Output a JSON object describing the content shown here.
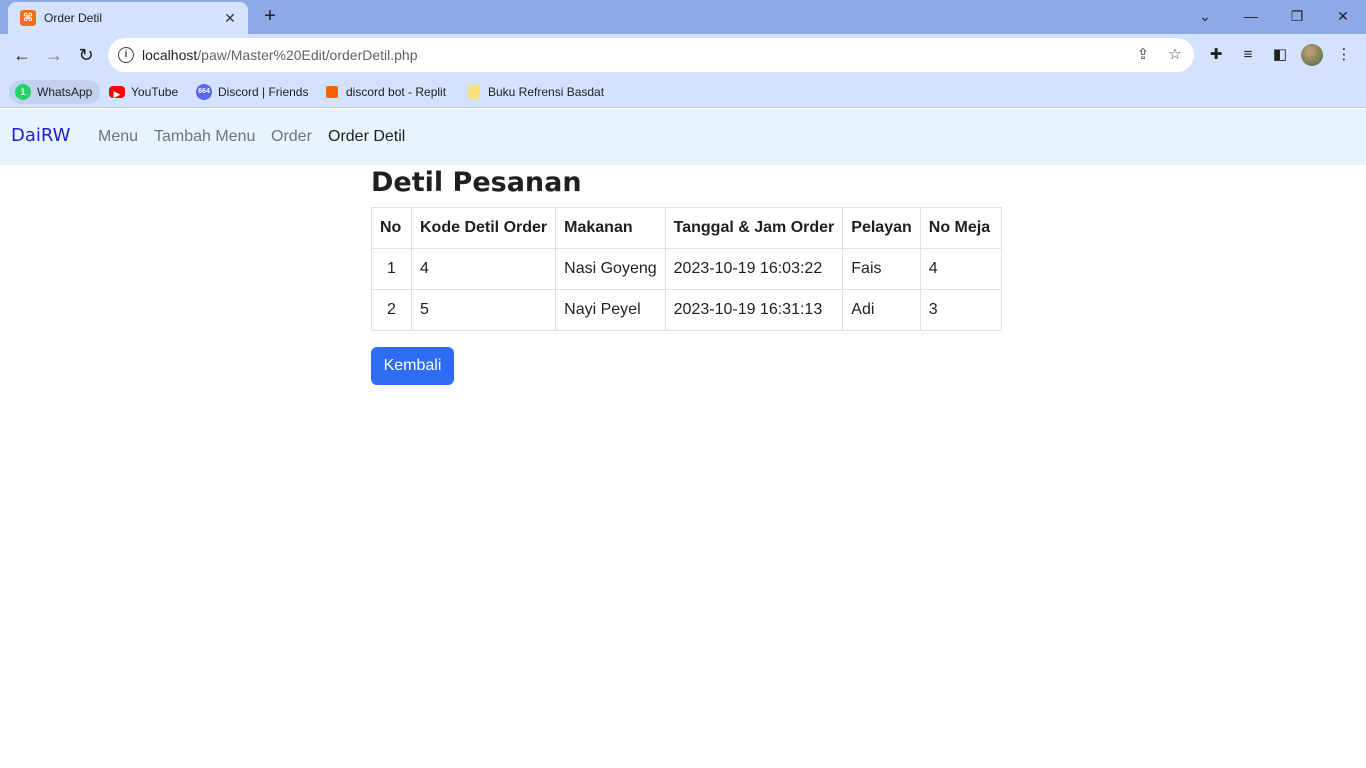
{
  "browser": {
    "tab_title": "Order Detil",
    "url_host": "localhost",
    "url_path": "/paw/Master%20Edit/orderDetil.php",
    "bookmarks": [
      {
        "label": "WhatsApp",
        "icon": "whatsapp-icon",
        "badge": "1",
        "color": "#25d366"
      },
      {
        "label": "YouTube",
        "icon": "youtube-icon",
        "color": "#ff0000"
      },
      {
        "label": "Discord | Friends",
        "icon": "discord-icon",
        "badge": "664",
        "color": "#5865f2"
      },
      {
        "label": "discord bot - Replit",
        "icon": "replit-icon",
        "color": "#f26207"
      },
      {
        "label": "Buku Refrensi Basdat",
        "icon": "folder-icon",
        "color": "#f9e27d"
      }
    ]
  },
  "site": {
    "brand": "DaiRW",
    "nav": [
      "Menu",
      "Tambah Menu",
      "Order",
      "Order Detil"
    ],
    "active_nav": "Order Detil"
  },
  "page": {
    "heading": "Detil Pesanan",
    "table": {
      "headers": [
        "No",
        "Kode Detil Order",
        "Makanan",
        "Tanggal & Jam Order",
        "Pelayan",
        "No Meja"
      ],
      "rows": [
        [
          "1",
          "4",
          "Nasi Goyeng",
          "2023-10-19 16:03:22",
          "Fais",
          "4"
        ],
        [
          "2",
          "5",
          "Nayi Peyel",
          "2023-10-19 16:31:13",
          "Adi",
          "3"
        ]
      ]
    },
    "back_button": "Kembali"
  },
  "colors": {
    "accent": "#2f6cf6",
    "navbar_bg": "#e7f4fd",
    "brand": "#2020d0"
  }
}
